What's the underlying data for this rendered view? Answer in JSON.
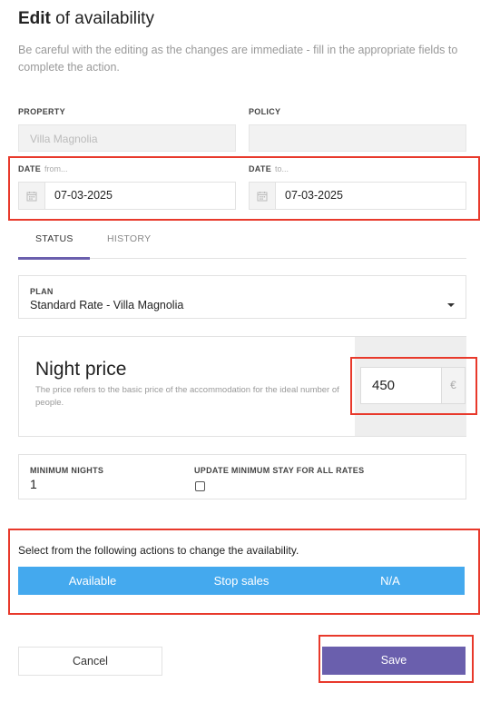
{
  "header": {
    "title_bold": "Edit",
    "title_rest": " of availability",
    "subtitle": "Be careful with the editing as the changes are immediate - fill in the appropriate fields to complete the action."
  },
  "property": {
    "label": "PROPERTY",
    "value": "Villa Magnolia"
  },
  "policy": {
    "label": "POLICY",
    "value": ""
  },
  "date_from": {
    "label": "DATE",
    "hint": "from...",
    "value": "07-03-2025",
    "icon": "calendar-icon"
  },
  "date_to": {
    "label": "DATE",
    "hint": "to...",
    "value": "07-03-2025",
    "icon": "calendar-icon"
  },
  "tabs": [
    {
      "label": "STATUS",
      "active": true
    },
    {
      "label": "HISTORY",
      "active": false
    }
  ],
  "plan": {
    "label": "PLAN",
    "value": "Standard Rate - Villa Magnolia"
  },
  "night_price": {
    "title": "Night price",
    "description": "The price refers to the basic price of the accommodation for the ideal number of people.",
    "value": "450",
    "currency": "€"
  },
  "min_nights": {
    "label": "MINIMUM NIGHTS",
    "value": "1"
  },
  "update_min_stay": {
    "label": "UPDATE MINIMUM STAY FOR ALL RATES",
    "checked": false
  },
  "actions": {
    "instruction": "Select from the following actions to change the availability.",
    "available": "Available",
    "stop_sales": "Stop sales",
    "na": "N/A"
  },
  "footer": {
    "cancel": "Cancel",
    "save": "Save"
  },
  "colors": {
    "accent": "#6a5fad",
    "action_bar": "#44a9ee",
    "highlight": "#e8392b"
  }
}
